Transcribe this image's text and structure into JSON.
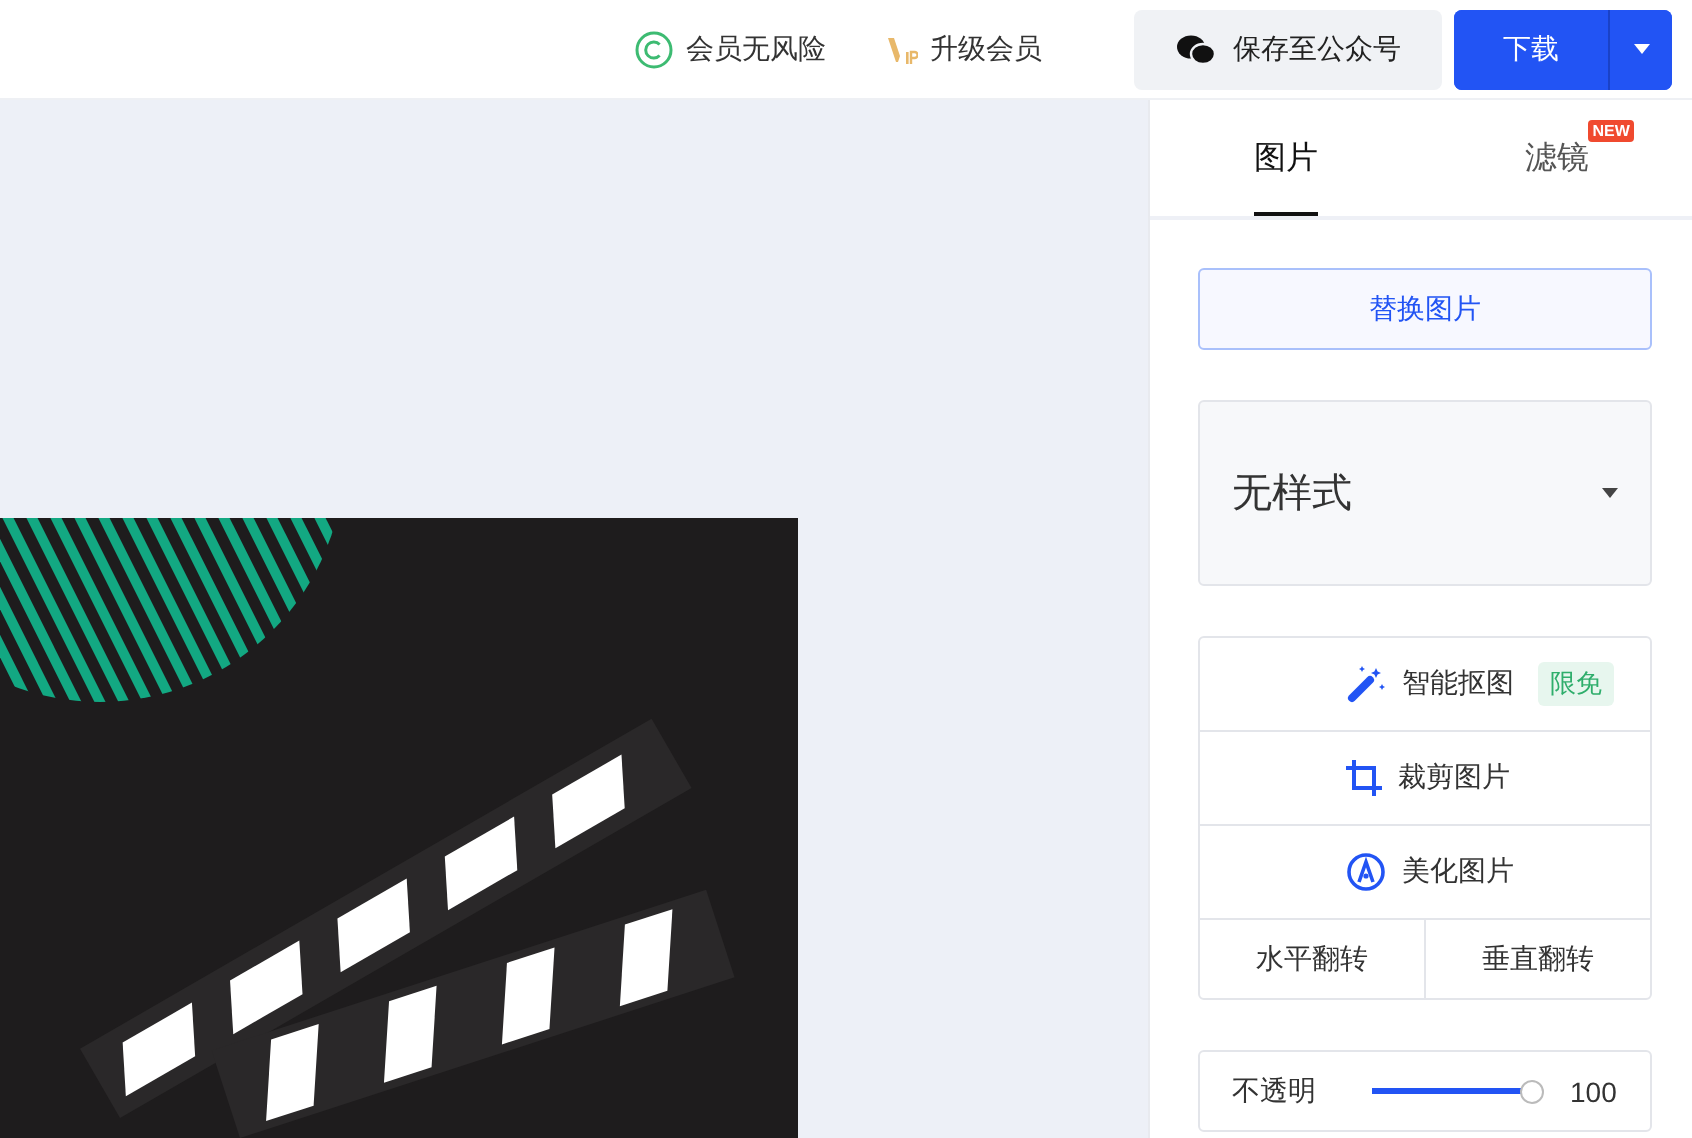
{
  "header": {
    "links": [
      {
        "kind": "copyright",
        "label": "会员无风险"
      },
      {
        "kind": "vip",
        "label": "升级会员"
      }
    ],
    "save_button": "保存至公众号",
    "download_button": "下载"
  },
  "panel": {
    "tabs": [
      {
        "label": "图片",
        "selected": true
      },
      {
        "label": "滤镜",
        "selected": false,
        "badge": "NEW"
      }
    ],
    "replace_button": "替换图片",
    "style_select": {
      "value": "无样式"
    },
    "tools": [
      {
        "kind": "magic",
        "label": "智能抠图",
        "tag": "限免"
      },
      {
        "kind": "crop",
        "label": "裁剪图片"
      },
      {
        "kind": "beautify",
        "label": "美化图片"
      }
    ],
    "flip_buttons": [
      "水平翻转",
      "垂直翻转"
    ],
    "opacity": {
      "label": "不透明",
      "level": 1,
      "reading": "100"
    }
  }
}
